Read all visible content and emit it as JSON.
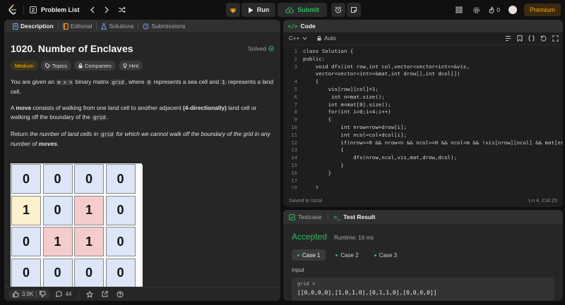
{
  "nav": {
    "problem_list": "Problem List",
    "run_label": "Run",
    "submit_label": "Submit",
    "streak_count": "0",
    "premium_label": "Premium"
  },
  "left_tabs": [
    "Description",
    "Editorial",
    "Solutions",
    "Submissions"
  ],
  "problem": {
    "title": "1020. Number of Enclaves",
    "status": "Solved",
    "difficulty": "Medium",
    "tags": [
      "Topics",
      "Companies",
      "Hint"
    ],
    "p1_a": "You are given an ",
    "p1_code1": "m x n",
    "p1_b": " binary matrix ",
    "p1_code2": "grid",
    "p1_c": ", where ",
    "p1_code3": "0",
    "p1_d": " represents a sea cell and ",
    "p1_code4": "1",
    "p1_e": " represents a land cell.",
    "p2_a": "A ",
    "p2_bold1": "move",
    "p2_b": " consists of walking from one land cell to another adjacent ",
    "p2_bold2": "(4-directionally)",
    "p2_c": " land cell or walking off the boundary of the ",
    "p2_code": "grid",
    "p2_d": ".",
    "p3_a": "Return ",
    "p3_i1": "the number of land cells in ",
    "p3_code": "grid",
    "p3_i2": " for which we cannot walk off the boundary of the grid in any number of ",
    "p3_bold": "moves",
    "p3_end": ".",
    "example_title": "Example 1:",
    "grid_values": [
      [
        "0",
        "0",
        "0",
        "0"
      ],
      [
        "1",
        "0",
        "1",
        "0"
      ],
      [
        "0",
        "1",
        "1",
        "0"
      ],
      [
        "0",
        "0",
        "0",
        "0"
      ]
    ],
    "grid_colors": {
      "sea": "#dce6f7",
      "land": "#f4cccc",
      "edge_land": "#fdf1cd"
    }
  },
  "footer": {
    "likes": "3.9K",
    "comments": "44"
  },
  "code_panel": {
    "title": "Code",
    "language": "C++",
    "mode": "Auto",
    "saved": "Saved to local",
    "position": "Ln 4, Col 25",
    "lines": [
      {
        "n": "1",
        "t": "class Solution {"
      },
      {
        "n": "2",
        "t": "public:"
      },
      {
        "n": "3",
        "t": "    void dfs(int row,int col,vector<vector<int>>&vis,"
      },
      {
        "n": "",
        "t": "    vector<vector<int>>&mat,int drow[],int dcol[])"
      },
      {
        "n": "4",
        "t": "    {"
      },
      {
        "n": "5",
        "t": "        vis[row][col]=1;"
      },
      {
        "n": "6",
        "t": "         int n=mat.size();"
      },
      {
        "n": "7",
        "t": "        int m=mat[0].size();"
      },
      {
        "n": "8",
        "t": "        for(int i=0;i<4;i++)"
      },
      {
        "n": "9",
        "t": "        {"
      },
      {
        "n": "10",
        "t": "            int nrow=row+drow[i];"
      },
      {
        "n": "11",
        "t": "            int ncol=col+dcol[i];"
      },
      {
        "n": "12",
        "t": "            if(nrow>=0 && nrow<n && ncol>=0 && ncol<m && !vis[nrow][ncol] && mat[nr"
      },
      {
        "n": "13",
        "t": "            {"
      },
      {
        "n": "14",
        "t": "                dfs(nrow,ncol,vis,mat,drow,dcol);"
      },
      {
        "n": "15",
        "t": "            }"
      },
      {
        "n": "16",
        "t": "        }"
      },
      {
        "n": "17",
        "t": ""
      },
      {
        "n": "18",
        "t": "    }"
      }
    ]
  },
  "test_panel": {
    "tab_testcase": "Testcase",
    "tab_result": "Test Result",
    "verdict": "Accepted",
    "runtime": "Runtime: 16 ms",
    "cases": [
      "Case 1",
      "Case 2",
      "Case 3"
    ],
    "input_label": "Input",
    "input_name": "grid =",
    "input_value": "[[0,0,0,0],[1,0,1,0],[0,1,1,0],[0,0,0,0]]"
  }
}
